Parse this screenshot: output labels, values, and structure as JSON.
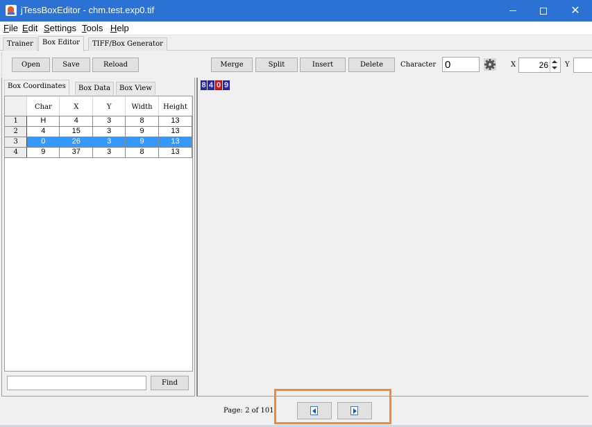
{
  "window": {
    "title": "jTessBoxEditor - chm.test.exp0.tif",
    "controls": [
      "minimize",
      "maximize",
      "close"
    ]
  },
  "menu": [
    {
      "label": "File",
      "mnemonic": "F"
    },
    {
      "label": "Edit",
      "mnemonic": "E"
    },
    {
      "label": "Settings",
      "mnemonic": "S"
    },
    {
      "label": "Tools",
      "mnemonic": "T"
    },
    {
      "label": "Help",
      "mnemonic": "H"
    }
  ],
  "main_tabs": [
    {
      "label": "Trainer",
      "active": false
    },
    {
      "label": "Box Editor",
      "active": true
    },
    {
      "label": "TIFF/Box Generator",
      "active": false
    }
  ],
  "toolbar": {
    "open": "Open",
    "save": "Save",
    "reload": "Reload",
    "merge": "Merge",
    "split": "Split",
    "insert": "Insert",
    "delete": "Delete",
    "character_label": "Character",
    "character_value": "0",
    "x_label": "X",
    "x_value": "26",
    "y_label": "Y",
    "y_value": ""
  },
  "sub_tabs": [
    {
      "label": "Box Coordinates",
      "active": true
    },
    {
      "label": "Box Data",
      "active": false
    },
    {
      "label": "Box View",
      "active": false
    }
  ],
  "table": {
    "columns": [
      "Char",
      "X",
      "Y",
      "Width",
      "Height"
    ],
    "rows": [
      {
        "index": "1",
        "char": "H",
        "x": "4",
        "y": "3",
        "width": "8",
        "height": "13",
        "selected": false
      },
      {
        "index": "2",
        "char": "4",
        "x": "15",
        "y": "3",
        "width": "9",
        "height": "13",
        "selected": false
      },
      {
        "index": "3",
        "char": "0",
        "x": "26",
        "y": "3",
        "width": "9",
        "height": "13",
        "selected": true
      },
      {
        "index": "4",
        "char": "9",
        "x": "37",
        "y": "3",
        "width": "8",
        "height": "13",
        "selected": false
      }
    ]
  },
  "find": {
    "value": "",
    "button": "Find"
  },
  "image_view": {
    "glyphs": [
      "8",
      "4",
      "0",
      "9"
    ],
    "selected_index": 2,
    "box_color": "#2a2aa0",
    "selected_color": "#cc1e1e"
  },
  "status": {
    "page_text": "Page: 2 of 101"
  },
  "nav": {
    "prev": "previous-page",
    "next": "next-page",
    "highlight_color": "#f08a34"
  }
}
